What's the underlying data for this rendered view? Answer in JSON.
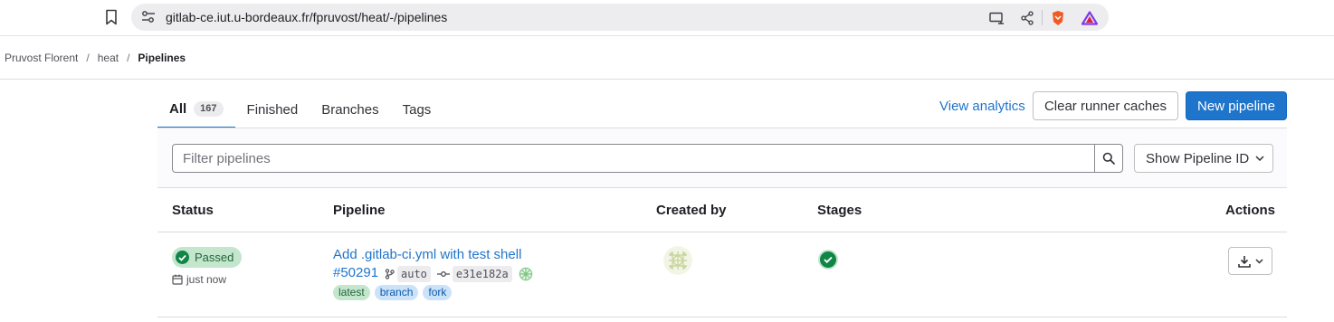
{
  "browser": {
    "url": "gitlab-ce.iut.u-bordeaux.fr/fpruvost/heat/-/pipelines",
    "icons": [
      "bookmark-icon",
      "site-settings-icon",
      "cast-icon",
      "share-icon",
      "brave-shields-icon",
      "brave-rewards-icon"
    ]
  },
  "breadcrumb": {
    "items": [
      "Pruvost Florent",
      "heat",
      "Pipelines"
    ],
    "separator": "/"
  },
  "tabs": [
    {
      "label": "All",
      "count": "167",
      "active": true
    },
    {
      "label": "Finished"
    },
    {
      "label": "Branches"
    },
    {
      "label": "Tags"
    }
  ],
  "header_actions": {
    "view_analytics": "View analytics",
    "clear_runner_caches": "Clear runner caches",
    "new_pipeline": "New pipeline"
  },
  "filter": {
    "placeholder": "Filter pipelines",
    "show_id_label": "Show Pipeline ID"
  },
  "table": {
    "columns": [
      "Status",
      "Pipeline",
      "Created by",
      "Stages",
      "Actions"
    ],
    "rows": [
      {
        "status": "Passed",
        "time": "just now",
        "title": "Add .gitlab-ci.yml with test shell",
        "id": "#50291",
        "ref": "auto",
        "sha": "e31e182a",
        "tags": [
          "latest",
          "branch",
          "fork"
        ],
        "stages": [
          "passed"
        ]
      }
    ]
  },
  "colors": {
    "accent": "#1f75cb",
    "success": "#108548",
    "success_bg": "#c3e6cd",
    "info_bg": "#cbe2f9"
  }
}
